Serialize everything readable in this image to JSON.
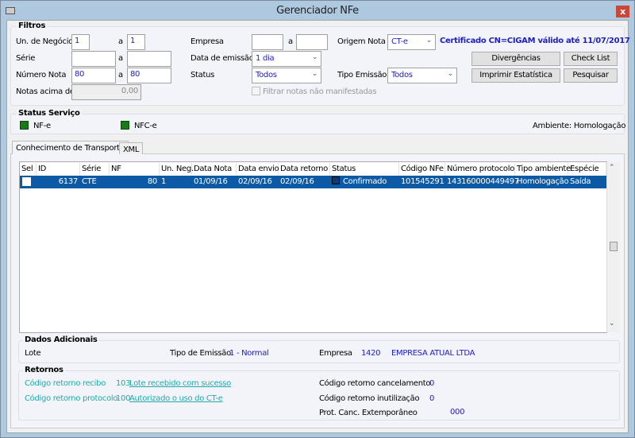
{
  "window": {
    "title": "Gerenciador NFe",
    "close": "x"
  },
  "filtros": {
    "title": "Filtros",
    "un_negocio": {
      "label": "Un. de Negócio",
      "from": "1",
      "to": "1"
    },
    "serie": {
      "label": "Série",
      "from": "",
      "to": ""
    },
    "numero_nota": {
      "label": "Número Nota",
      "from": "80",
      "to": "80"
    },
    "notas_acima": {
      "label": "Notas acima de",
      "value": "0,00"
    },
    "sep": "a",
    "empresa": {
      "label": "Empresa",
      "from": "",
      "to": ""
    },
    "data_emissao": {
      "label": "Data de emissão",
      "value": "1 dia"
    },
    "status": {
      "label": "Status",
      "value": "Todos"
    },
    "filtrar_label": "Filtrar notas não manifestadas",
    "origem": {
      "label": "Origem Nota",
      "value": "CT-e"
    },
    "tipo_emissao": {
      "label": "Tipo Emissão",
      "value": "Todos"
    },
    "certificado": "Certificado CN=CIGAM válido até 11/07/2017",
    "buttons": {
      "divergencias": "Divergências",
      "checklist": "Check List",
      "imprimir": "Imprimir Estatística",
      "pesquisar": "Pesquisar"
    }
  },
  "status_servico": {
    "title": "Status Serviço",
    "nfe": "NF-e",
    "nfce": "NFC-e",
    "ambiente": "Ambiente: Homologação",
    "indicator_color": "#1a7a1a"
  },
  "tabs": [
    "Conhecimento de Transporte",
    "XML"
  ],
  "grid": {
    "columns": [
      "Sel",
      "ID",
      "Série",
      "NF",
      "Un. Neg.",
      "Data Nota",
      "Data envio",
      "Data retorno",
      "Status",
      "Código NFe",
      "Número protocolo",
      "Tipo ambiente",
      "Espécie"
    ],
    "rows": [
      {
        "sel": false,
        "id": "6137",
        "serie": "CTE",
        "nf": "80",
        "un_neg": "1",
        "data_nota": "01/09/16",
        "data_envio": "02/09/16",
        "data_retorno": "02/09/16",
        "status": "Confirmado",
        "codigo_nfe": "101545291",
        "protocolo": "143160000449497",
        "tipo_ambiente": "Homologação",
        "especie": "Saída"
      }
    ],
    "selected_color": "#0c5aa6"
  },
  "dados": {
    "title": "Dados Adicionais",
    "lote": "Lote",
    "tipo_emissao_label": "Tipo de Emissão",
    "tipo_emissao": "1 - Normal",
    "empresa_label": "Empresa",
    "empresa_code": "1420",
    "empresa_name": "EMPRESA ATUAL LTDA"
  },
  "retornos": {
    "title": "Retornos",
    "recibo_label": "Código retorno recibo",
    "recibo_code": "103",
    "recibo_msg": "Lote recebido com sucesso",
    "protocolo_label": "Código retorno protocolo",
    "protocolo_code": "100",
    "protocolo_msg": "Autorizado o uso do CT-e",
    "cancel_label": "Código retorno cancelamento",
    "cancel_value": "0",
    "inut_label": "Código retorno inutilização",
    "inut_value": "0",
    "extemp_label": "Prot. Canc. Extemporâneo",
    "extemp_value": "000"
  }
}
